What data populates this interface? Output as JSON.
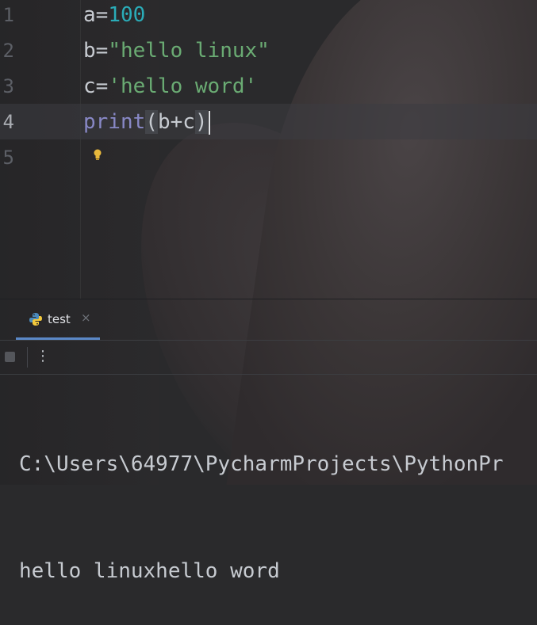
{
  "editor": {
    "lines": [
      {
        "number": "1",
        "var": "a",
        "eq": "=",
        "value": "100"
      },
      {
        "number": "2",
        "var": "b",
        "eq": "=",
        "value": "\"hello linux\""
      },
      {
        "number": "3",
        "var": "c",
        "eq": "=",
        "value": "'hello word'"
      },
      {
        "number": "4",
        "func": "print",
        "open": "(",
        "args": "b+c",
        "close": ")"
      },
      {
        "number": "5"
      }
    ]
  },
  "run_panel": {
    "tab_label": "test",
    "tab_close": "×",
    "more_menu": "⋮"
  },
  "console": {
    "lines": [
      "C:\\Users\\64977\\PycharmProjects\\PythonPr",
      "hello linuxhello word"
    ]
  },
  "colors": {
    "number": "#2aacb8",
    "string": "#6aab73",
    "builtin": "#8888c6",
    "text": "#c7cbd1",
    "tab_underline": "#5b88c7"
  }
}
